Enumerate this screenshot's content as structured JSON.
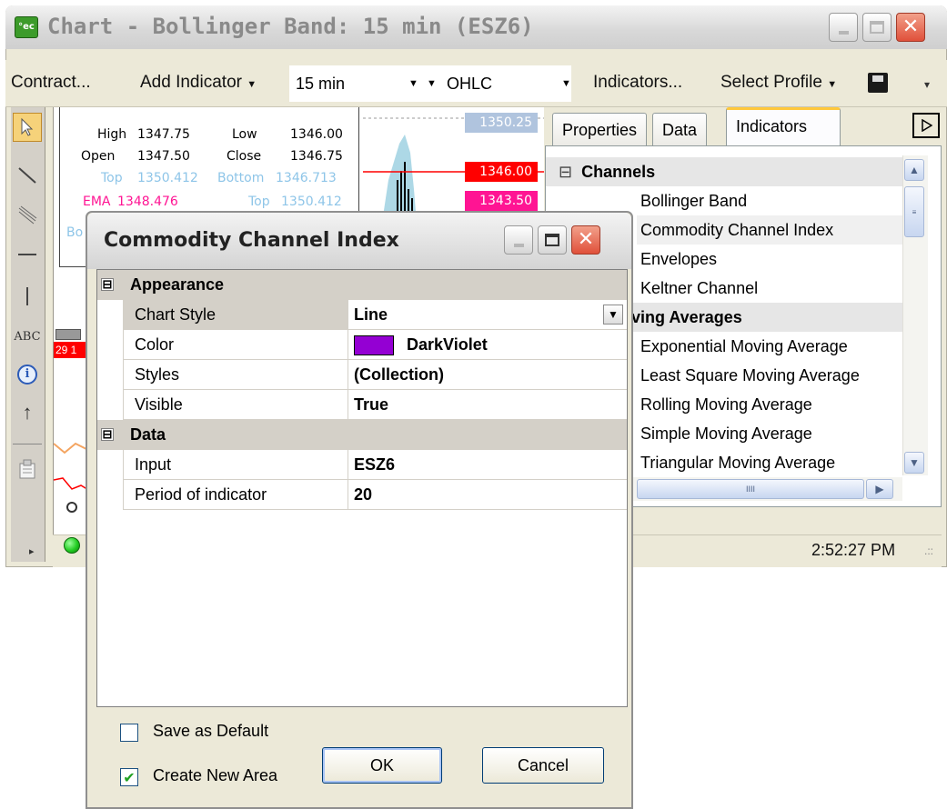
{
  "window": {
    "title": "Chart - Bollinger Band: 15 min (ESZ6)",
    "app_icon_text": "°ec"
  },
  "toolbar": {
    "contract": "Contract...",
    "add_indicator": "Add Indicator",
    "interval": "15 min",
    "chart_type": "OHLC",
    "indicators": "Indicators...",
    "select_profile": "Select Profile"
  },
  "tools": [
    "cursor-icon",
    "line-icon",
    "parallel-lines-icon",
    "horizontal-line-icon",
    "vertical-line-icon",
    "text-icon",
    "info-icon",
    "arrow-up-icon",
    "properties-icon"
  ],
  "tool_text_label": "ABC",
  "chart": {
    "info": {
      "high_label": "High",
      "high": "1347.75",
      "low_label": "Low",
      "low": "1346.00",
      "open_label": "Open",
      "open": "1347.50",
      "close_label": "Close",
      "close": "1346.75",
      "top_label": "Top",
      "top": "1350.412",
      "bottom_label": "Bottom",
      "bottom": "1346.713",
      "ema_label": "EMA",
      "ema": "1348.476",
      "top2_label": "Top",
      "top2": "1350.412",
      "partial_bo": "Bo"
    },
    "price_tags": [
      "1350.25",
      "1346.00",
      "1343.50"
    ],
    "partial_label": "29 1",
    "colors": {
      "bollinger": "#add8e6",
      "ema": "#ff1493",
      "price_red": "#ff0000",
      "tag_gray": "#b0c4de"
    }
  },
  "right_panel": {
    "tabs": [
      "Properties",
      "Data",
      "Indicators"
    ],
    "active_tab": "Indicators",
    "list": [
      {
        "text": "Channels",
        "type": "category"
      },
      {
        "text": "Bollinger Band",
        "type": "item"
      },
      {
        "text": "Commodity Channel Index",
        "type": "item"
      },
      {
        "text": "Envelopes",
        "type": "item"
      },
      {
        "text": "Keltner Channel",
        "type": "item"
      },
      {
        "text": "ving Averages",
        "type": "category"
      },
      {
        "text": "Exponential Moving Average",
        "type": "item"
      },
      {
        "text": "Least Square Moving Average",
        "type": "item"
      },
      {
        "text": "Rolling Moving Average",
        "type": "item"
      },
      {
        "text": "Simple Moving Average",
        "type": "item"
      },
      {
        "text": "Triangular Moving Average",
        "type": "item"
      }
    ],
    "collapse_glyph": "⊟",
    "hscroll_grip": "IIII"
  },
  "status": {
    "time": "2:52:27 PM",
    "connection_color": "#22cc22"
  },
  "dialog": {
    "title": "Commodity Channel Index",
    "expander": "⊟",
    "sections": [
      {
        "name": "Appearance",
        "rows": [
          {
            "name": "Chart Style",
            "value": "Line",
            "dropdown": true
          },
          {
            "name": "Color",
            "value": "DarkViolet",
            "swatch": "#9400d3"
          },
          {
            "name": "Styles",
            "value": "(Collection)"
          },
          {
            "name": "Visible",
            "value": "True"
          }
        ]
      },
      {
        "name": "Data",
        "rows": [
          {
            "name": "Input",
            "value": "ESZ6"
          },
          {
            "name": "Period of indicator",
            "value": "20"
          }
        ]
      }
    ],
    "save_default_label": "Save as Default",
    "save_default_checked": false,
    "create_area_label": "Create New Area",
    "create_area_checked": true,
    "ok": "OK",
    "cancel": "Cancel",
    "check_glyph": "✔"
  }
}
